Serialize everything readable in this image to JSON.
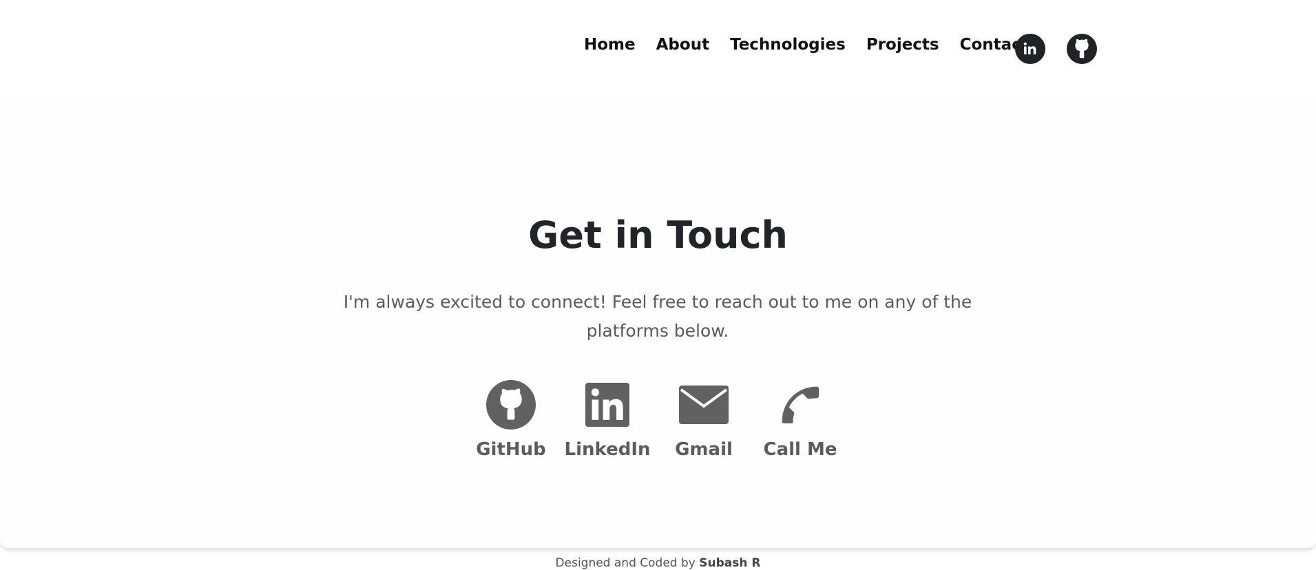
{
  "nav": {
    "links": [
      "Home",
      "About",
      "Technologies",
      "Projects",
      "Contact"
    ],
    "social_icons": [
      "linkedin-icon",
      "github-icon"
    ]
  },
  "contact": {
    "title": "Get in Touch",
    "description": "I'm always excited to connect! Feel free to reach out to me on any of the platforms below.",
    "links": [
      {
        "label": "GitHub",
        "icon": "github-icon"
      },
      {
        "label": "LinkedIn",
        "icon": "linkedin-icon"
      },
      {
        "label": "Gmail",
        "icon": "mail-icon"
      },
      {
        "label": "Call Me",
        "icon": "phone-icon"
      }
    ]
  },
  "footer": {
    "prefix": "Designed and Coded by",
    "author": "Subash R"
  },
  "colors": {
    "text_dark": "#212529",
    "icon_gray": "#616161",
    "nav_icon_bg": "#1f2326"
  }
}
